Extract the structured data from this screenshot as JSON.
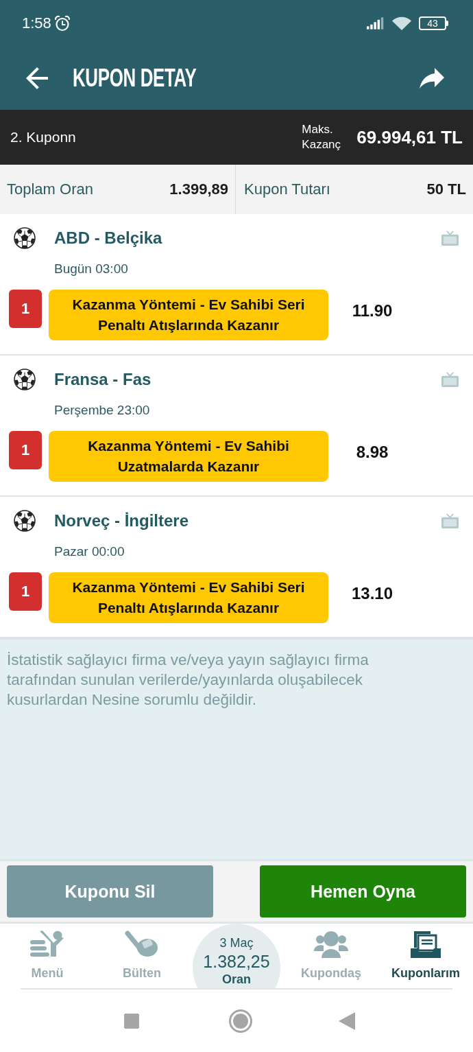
{
  "status_bar": {
    "time": "1:58",
    "battery": "43"
  },
  "app_bar": {
    "title": "KUPON DETAY"
  },
  "coupon_header": {
    "name": "2. Kuponn",
    "max_win_label": "Maks. Kazanç",
    "max_win": "69.994,61 TL"
  },
  "summary": [
    {
      "label": "Toplam Oran",
      "value": "1.399,89"
    },
    {
      "label": "Kupon Tutarı",
      "value": "50 TL"
    }
  ],
  "matches": [
    {
      "teams": "ABD - Belçika",
      "date": "Bugün 03:00",
      "pick": "1",
      "selection": "Kazanma Yöntemi - Ev Sahibi Seri Penaltı Atışlarında Kazanır",
      "odds": "11.90"
    },
    {
      "teams": "Fransa - Fas",
      "date": "Perşembe 23:00",
      "pick": "1",
      "selection": "Kazanma Yöntemi - Ev Sahibi Uzatmalarda Kazanır",
      "odds": "8.98"
    },
    {
      "teams": "Norveç - İngiltere",
      "date": "Pazar 00:00",
      "pick": "1",
      "selection": "Kazanma Yöntemi - Ev Sahibi Seri Penaltı Atışlarında Kazanır",
      "odds": "13.10"
    }
  ],
  "disclaimer": "İstatistik sağlayıcı firma ve/veya yayın sağlayıcı firma tarafından sunulan verilerde/yayınlarda oluşabilecek kusurlardan Nesine sorumlu değildir.",
  "buttons": [
    {
      "label": "Kuponu Sil",
      "kind": "secondary"
    },
    {
      "label": "Hemen Oyna",
      "kind": "primary"
    }
  ],
  "bottom_nav": {
    "items": [
      {
        "kind": "menu",
        "label": "Menü",
        "selected": false
      },
      {
        "kind": "bulletin",
        "label": "Bülten",
        "selected": false
      },
      {
        "kind": "slip",
        "count": "3 Maç",
        "odds": "1.382,25",
        "label": "Oran",
        "selected": false
      },
      {
        "kind": "community",
        "label": "Kupondaş",
        "selected": false
      },
      {
        "kind": "coupons",
        "label": "Kuponlarım",
        "selected": true
      }
    ]
  }
}
